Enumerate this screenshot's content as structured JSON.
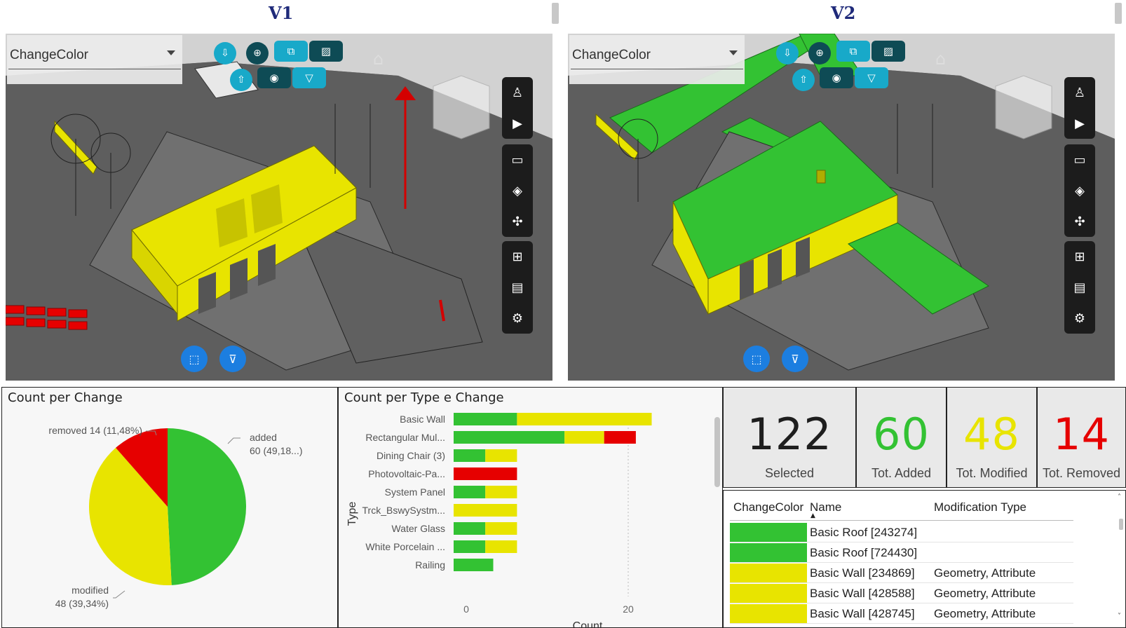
{
  "header": {
    "v1_title": "V1",
    "v2_title": "V2"
  },
  "viewers": [
    {
      "dropdown_value": "ChangeColor"
    },
    {
      "dropdown_value": "ChangeColor"
    }
  ],
  "colors": {
    "added": "#33c233",
    "modified": "#e8e400",
    "removed": "#e60000",
    "blue_button": "#1c7ee0",
    "cyan_button": "#18a9c9"
  },
  "icons": [
    "expand-down-icon",
    "focus-icon",
    "copy-icon",
    "hatch-icon",
    "expand-up-icon",
    "target-icon",
    "filter-icon",
    "home-icon",
    "walk-icon",
    "camera-icon",
    "ruler-icon",
    "cube-icon",
    "explode-icon",
    "tree-icon",
    "properties-icon",
    "settings-icon",
    "select-box-icon",
    "clear-filter-icon",
    "view-cube-icon"
  ],
  "pie": {
    "title": "Count per Change",
    "labels": [
      {
        "line1": "removed 14 (11,48%)"
      },
      {
        "line1": "added",
        "line2": "60 (49,18...)"
      },
      {
        "line1": "modified",
        "line2": "48 (39,34%)"
      }
    ]
  },
  "bar": {
    "title": "Count per Type e Change",
    "ylabel": "Type",
    "xlabel": "Count",
    "ticks": [
      "0",
      "20"
    ]
  },
  "kpis": [
    {
      "value": "122",
      "label": "Selected"
    },
    {
      "value": "60",
      "label": "Tot. Added"
    },
    {
      "value": "48",
      "label": "Tot. Modified"
    },
    {
      "value": "14",
      "label": "Tot. Removed"
    }
  ],
  "table": {
    "headers": [
      "ChangeColor",
      "Name",
      "Modification Type"
    ],
    "rows": [
      {
        "color": "added",
        "name": "Basic Roof [243274]",
        "mod": ""
      },
      {
        "color": "added",
        "name": "Basic Roof [724430]",
        "mod": ""
      },
      {
        "color": "modified",
        "name": "Basic Wall [234869]",
        "mod": "Geometry, Attribute"
      },
      {
        "color": "modified",
        "name": "Basic Wall [428588]",
        "mod": "Geometry, Attribute"
      },
      {
        "color": "modified",
        "name": "Basic Wall [428745]",
        "mod": "Geometry, Attribute"
      }
    ]
  },
  "chart_data": [
    {
      "type": "pie",
      "title": "Count per Change",
      "slices": [
        {
          "label": "added",
          "value": 60,
          "percent": "49,18%"
        },
        {
          "label": "modified",
          "value": 48,
          "percent": "39,34%"
        },
        {
          "label": "removed",
          "value": 14,
          "percent": "11,48%"
        }
      ]
    },
    {
      "type": "bar",
      "orientation": "horizontal",
      "stacked": true,
      "title": "Count per Type e Change",
      "xlabel": "Count",
      "ylabel": "Type",
      "categories": [
        "Basic Wall",
        "Rectangular Mul...",
        "Dining Chair (3)",
        "Photovoltaic-Pa...",
        "System Panel",
        "Trck_BswySystm...",
        "Water Glass",
        "White Porcelain ...",
        "Railing"
      ],
      "series": [
        {
          "name": "added",
          "values": [
            8,
            14,
            4,
            0,
            4,
            0,
            4,
            4,
            5
          ]
        },
        {
          "name": "modified",
          "values": [
            17,
            5,
            4,
            0,
            4,
            8,
            4,
            4,
            0
          ]
        },
        {
          "name": "removed",
          "values": [
            0,
            4,
            0,
            8,
            0,
            0,
            0,
            0,
            0
          ]
        }
      ],
      "xlim": [
        0,
        30
      ],
      "xticks": [
        0,
        20
      ]
    }
  ]
}
